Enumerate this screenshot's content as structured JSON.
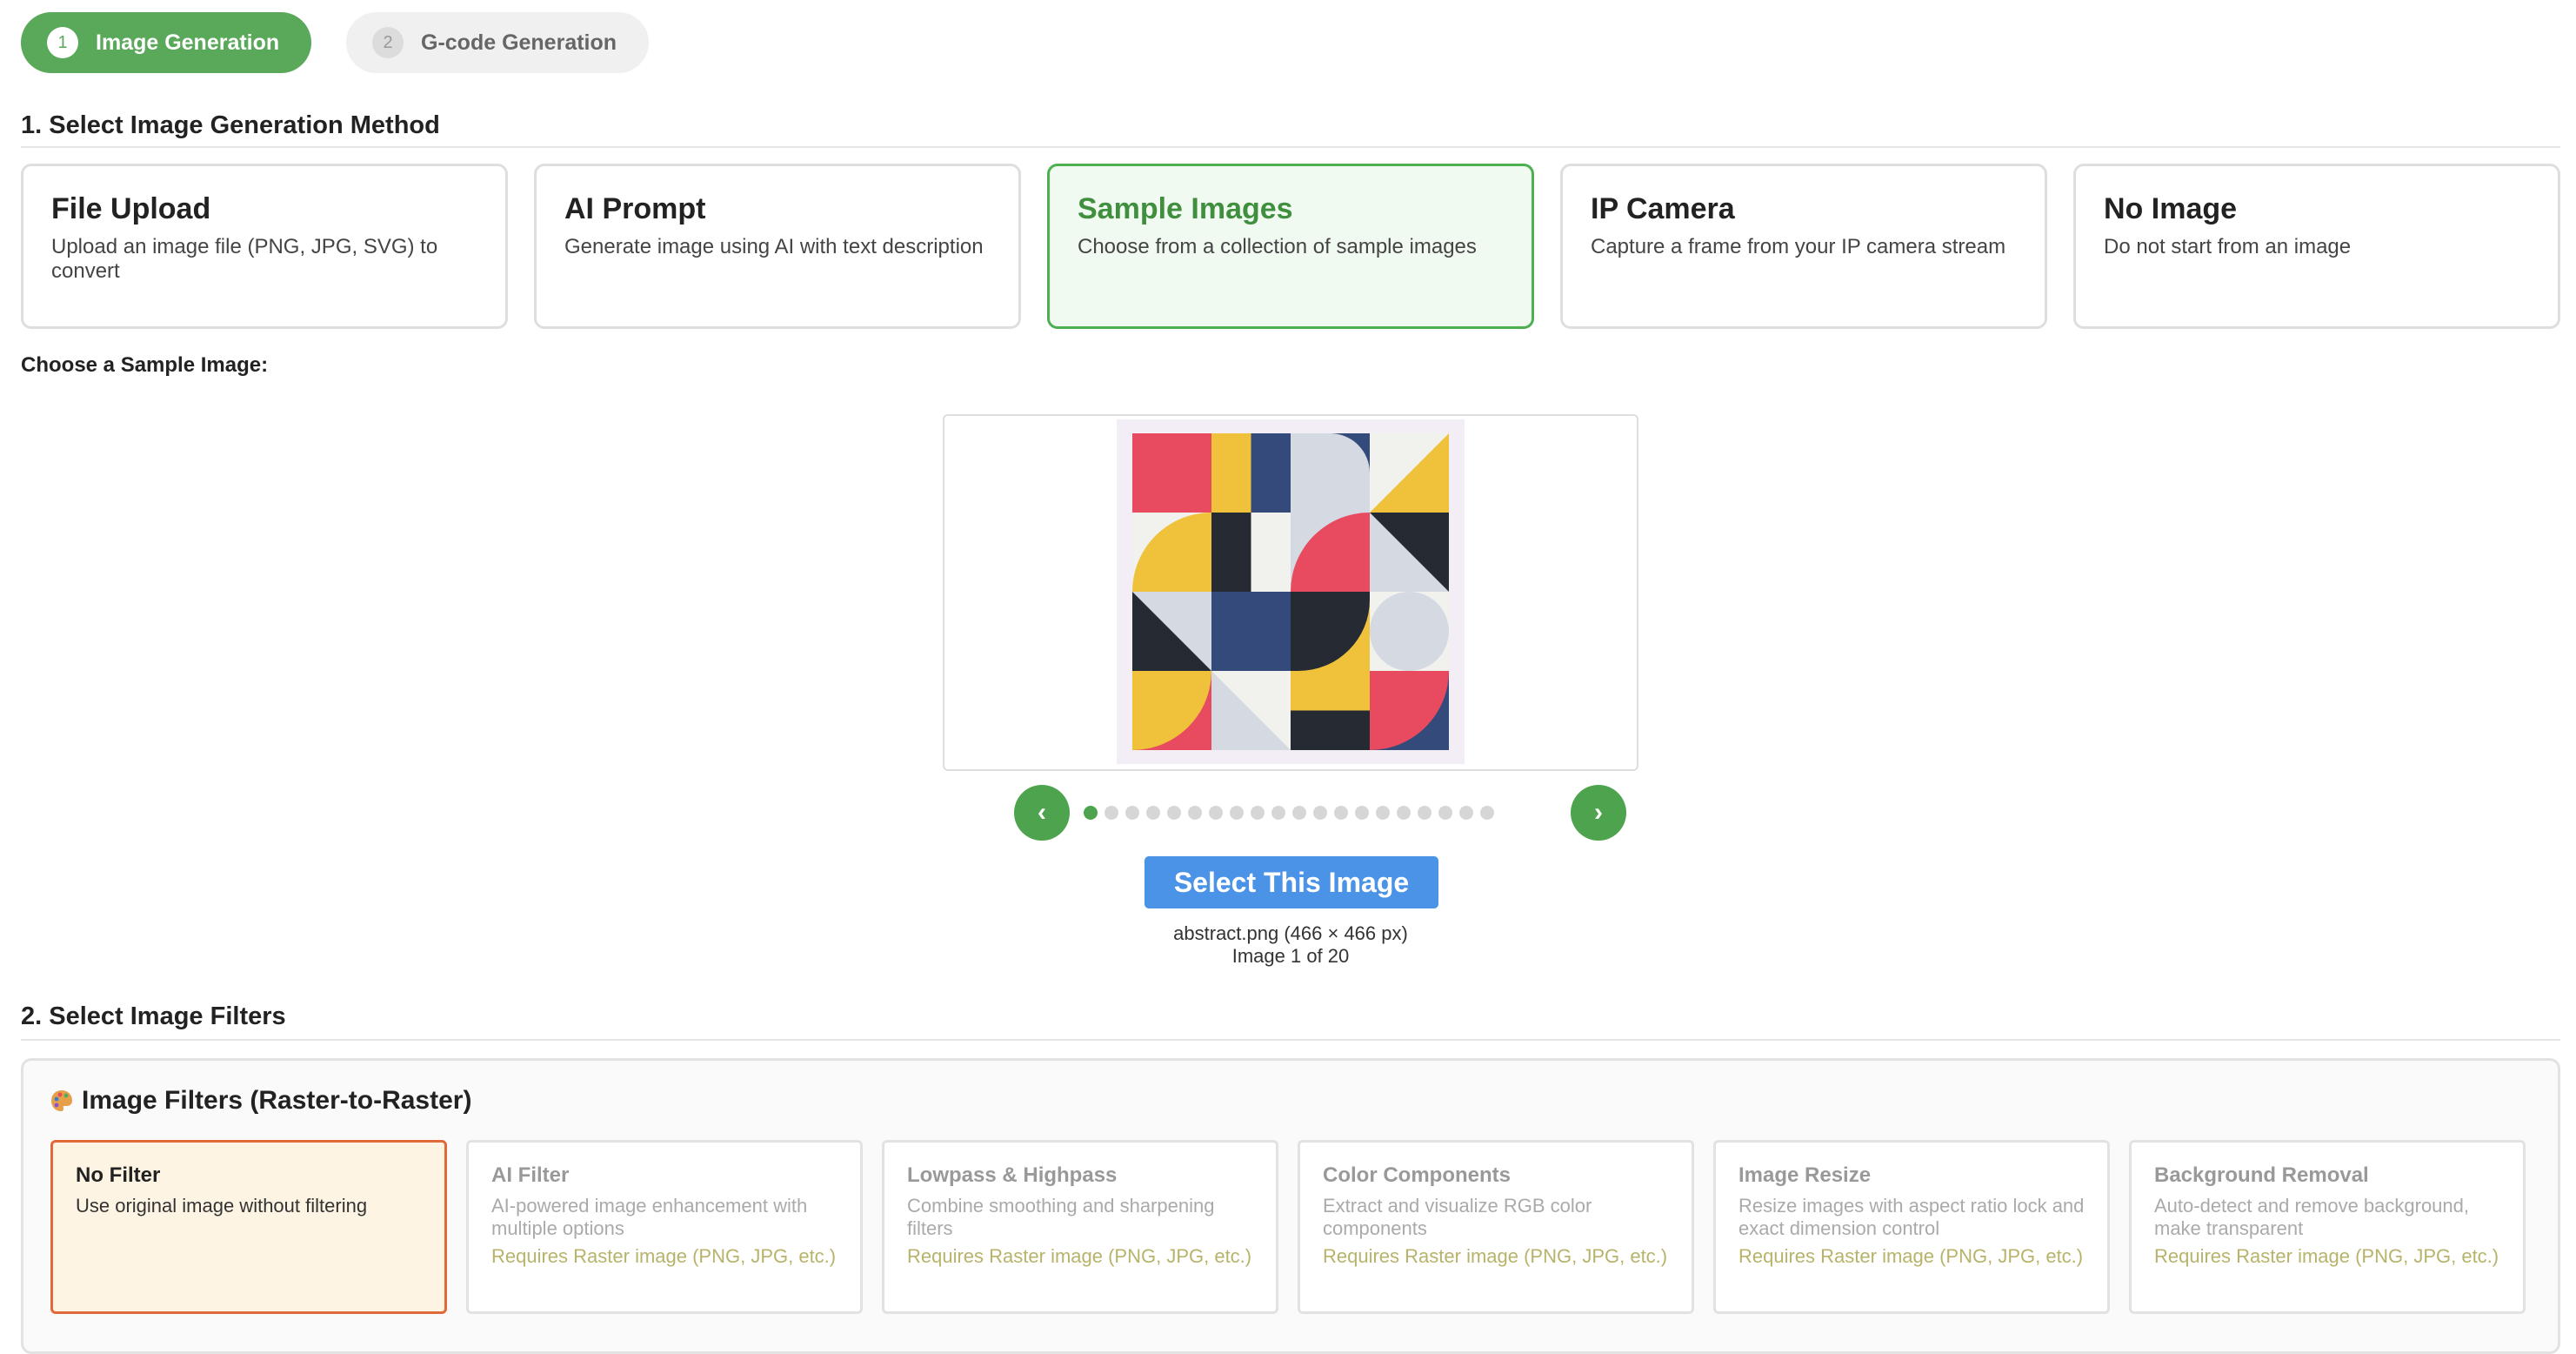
{
  "steps": [
    {
      "num": "1",
      "label": "Image Generation"
    },
    {
      "num": "2",
      "label": "G-code Generation"
    }
  ],
  "section1": {
    "title": "1. Select Image Generation Method"
  },
  "methods": [
    {
      "title": "File Upload",
      "desc": "Upload an image file (PNG, JPG, SVG) to convert"
    },
    {
      "title": "AI Prompt",
      "desc": "Generate image using AI with text description"
    },
    {
      "title": "Sample Images",
      "desc": "Choose from a collection of sample images"
    },
    {
      "title": "IP Camera",
      "desc": "Capture a frame from your IP camera stream"
    },
    {
      "title": "No Image",
      "desc": "Do not start from an image"
    }
  ],
  "sample": {
    "label": "Choose a Sample Image:",
    "prev": "‹",
    "next": "›",
    "dots_total": 20,
    "dots_active": 1,
    "select_button": "Select This Image",
    "filename": "abstract.png (466 × 466 px)",
    "counter": "Image 1 of 20"
  },
  "section2": {
    "title": "2. Select Image Filters"
  },
  "filters_panel": {
    "heading": "Image Filters (Raster-to-Raster)",
    "icon": "palette-icon",
    "items": [
      {
        "title": "No Filter",
        "desc": "Use original image without filtering",
        "req": ""
      },
      {
        "title": "AI Filter",
        "desc": "AI-powered image enhancement with multiple options",
        "req": "Requires Raster image (PNG, JPG, etc.)"
      },
      {
        "title": "Lowpass & Highpass",
        "desc": "Combine smoothing and sharpening filters",
        "req": "Requires Raster image (PNG, JPG, etc.)"
      },
      {
        "title": "Color Components",
        "desc": "Extract and visualize RGB color components",
        "req": "Requires Raster image (PNG, JPG, etc.)"
      },
      {
        "title": "Image Resize",
        "desc": "Resize images with aspect ratio lock and exact dimension control",
        "req": "Requires Raster image (PNG, JPG, etc.)"
      },
      {
        "title": "Background Removal",
        "desc": "Auto-detect and remove background, make transparent",
        "req": "Requires Raster image (PNG, JPG, etc.)"
      }
    ]
  },
  "colors": {
    "accent_green": "#5aa85a",
    "selected_border": "#4caf50",
    "button_blue": "#4a93e6",
    "filter_selected_border": "#e0693a",
    "art_red": "#e84a5f",
    "art_yellow": "#f0c23b",
    "art_navy": "#344a7a",
    "art_dark": "#262a33",
    "art_light": "#d4d9e2",
    "art_white": "#f1f1ee"
  }
}
